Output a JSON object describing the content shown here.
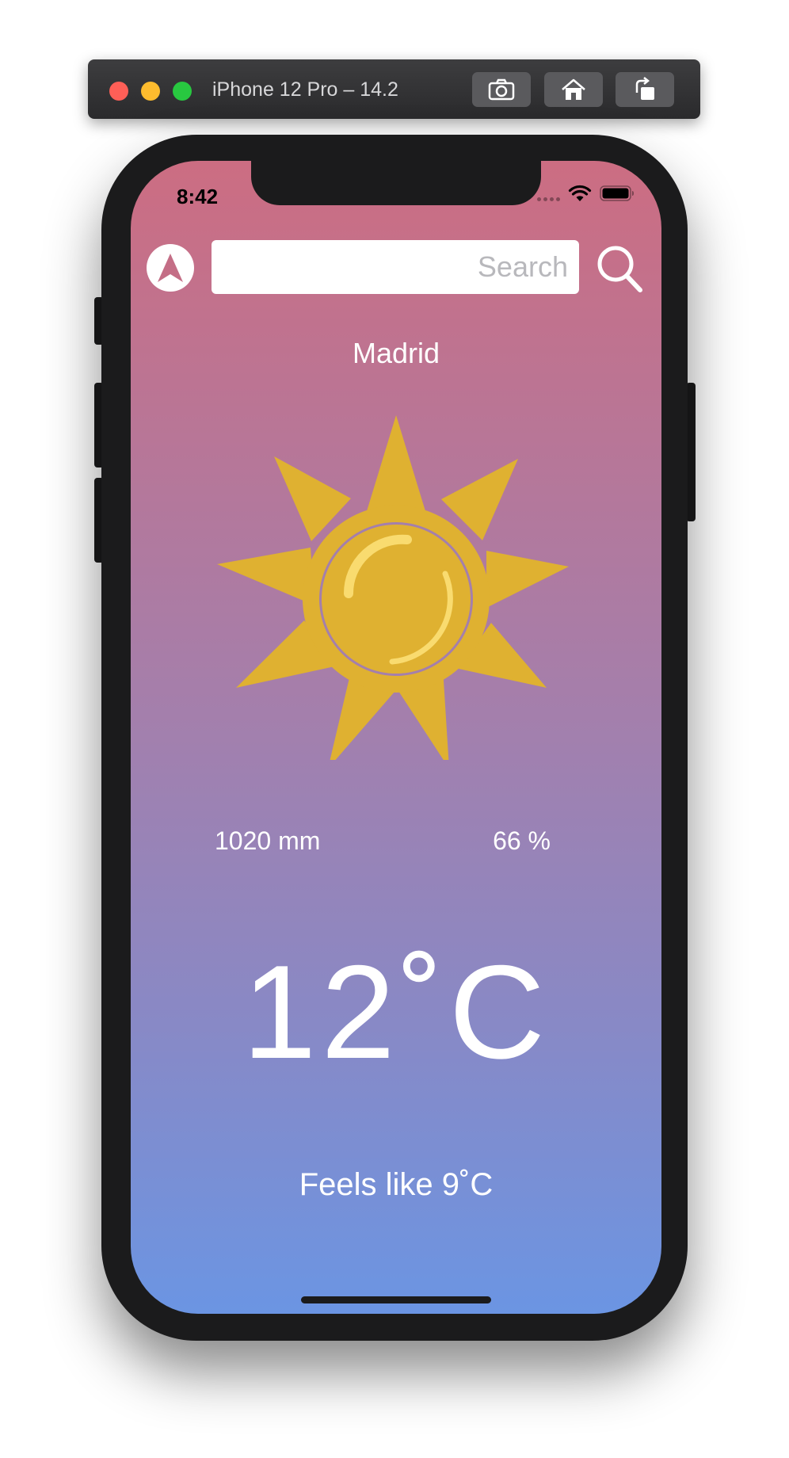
{
  "simulator": {
    "title": "iPhone 12 Pro – 14.2",
    "buttons": [
      "screenshot-icon",
      "home-icon",
      "rotate-icon"
    ]
  },
  "status_bar": {
    "time": "8:42",
    "icons": [
      "signal-dots-icon",
      "wifi-icon",
      "battery-icon"
    ]
  },
  "search": {
    "placeholder": "Search",
    "value": ""
  },
  "weather": {
    "city": "Madrid",
    "pressure": "1020 mm",
    "humidity": "66 %",
    "temperature": "12˚C",
    "feels_like": "Feels like 9˚C",
    "icon": "sun-icon"
  },
  "colors": {
    "gradient_top": "#cc6d82",
    "gradient_bottom": "#6b95e3",
    "sun": "#dfb131",
    "sun_highlight": "#f9db6f"
  }
}
